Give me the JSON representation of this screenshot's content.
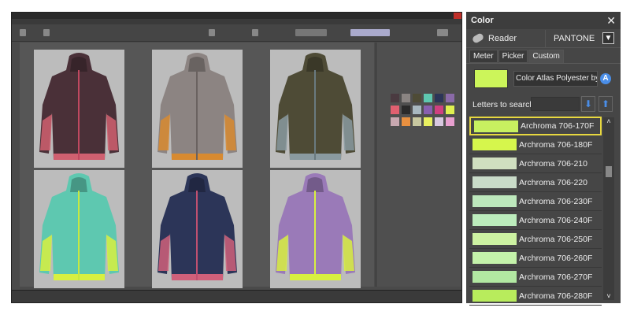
{
  "panel": {
    "title": "Color",
    "reader_label": "Reader",
    "brand_label": "PANTONE",
    "tabs": [
      {
        "label": "Meter"
      },
      {
        "label": "Picker"
      },
      {
        "label": "Custom"
      }
    ],
    "current_color": "#ccf55a",
    "library_select": "Color Atlas Polyester by",
    "search_label": "Letters to search",
    "search_value": "",
    "colors": [
      {
        "name": "Archroma 706-170F",
        "hex": "#c8f060"
      },
      {
        "name": "Archroma 706-180F",
        "hex": "#d6f64c"
      },
      {
        "name": "Archroma 706-210",
        "hex": "#d0dfc0"
      },
      {
        "name": "Archroma 706-220",
        "hex": "#c9dbc8"
      },
      {
        "name": "Archroma 706-230F",
        "hex": "#bde8bc"
      },
      {
        "name": "Archroma 706-240F",
        "hex": "#bcecbc"
      },
      {
        "name": "Archroma 706-250F",
        "hex": "#cdf2a2"
      },
      {
        "name": "Archroma 706-260F",
        "hex": "#c4f2aa"
      },
      {
        "name": "Archroma 706-270F",
        "hex": "#b2e8a2"
      },
      {
        "name": "Archroma 706-280F",
        "hex": "#b8ec5c"
      }
    ]
  },
  "jackets": [
    {
      "body": "#4a3038",
      "accent": "#d06070",
      "zip": "#c04860"
    },
    {
      "body": "#8c8482",
      "accent": "#d88a30",
      "zip": "#6a6260"
    },
    {
      "body": "#4e4b36",
      "accent": "#8a9aa0",
      "zip": "#6a7a80"
    },
    {
      "body": "#5ec8b0",
      "accent": "#d8f040",
      "zip": "#c8e840"
    },
    {
      "body": "#2c3558",
      "accent": "#d0607a",
      "zip": "#c05070"
    },
    {
      "body": "#9a7ab8",
      "accent": "#d8f040",
      "zip": "#d8f040"
    }
  ],
  "palette": [
    "#4a3a40",
    "#8a8482",
    "#4e4b36",
    "#5ec8b0",
    "#2c3558",
    "#8a6aa8",
    "#e06070",
    "#2a2a2a",
    "#a8b8c0",
    "#8860b0",
    "#d04080",
    "#e0f050",
    "#c8a8b0",
    "#e89040",
    "#c8c8a0",
    "#e8f060",
    "#d8c8e0",
    "#e8a0d0"
  ]
}
